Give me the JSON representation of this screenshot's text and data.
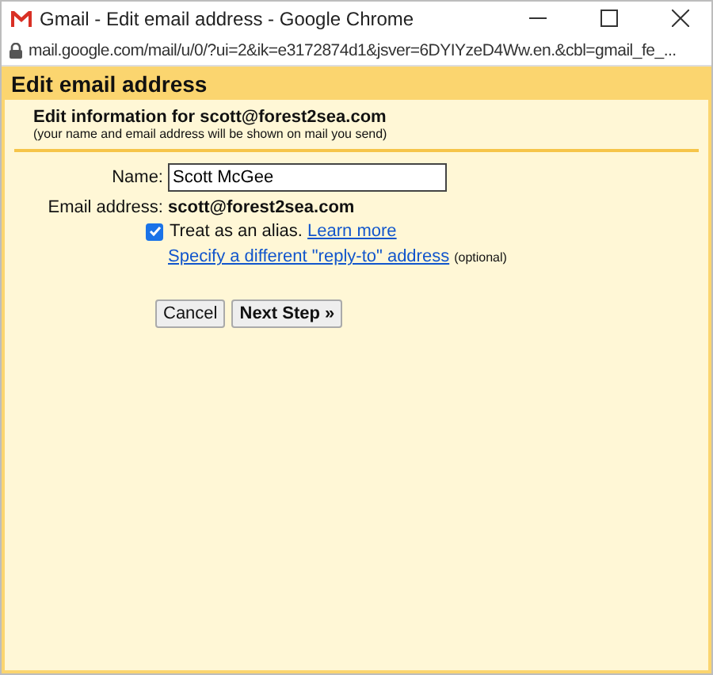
{
  "window": {
    "title": "Gmail - Edit email address - Google Chrome",
    "url": "mail.google.com/mail/u/0/?ui=2&ik=e3172874d1&jsver=6DYIYzeD4Ww.en.&cbl=gmail_fe_..."
  },
  "dialog": {
    "title": "Edit email address",
    "heading": "Edit information for scott@forest2sea.com",
    "subheading": "(your name and email address will be shown on mail you send)",
    "fields": [
      {
        "label": "Name:",
        "kind": "input",
        "value": "Scott McGee"
      },
      {
        "label": "Email address:",
        "kind": "static",
        "value": "scott@forest2sea.com"
      }
    ],
    "alias": {
      "checked": true,
      "label": "Treat as an alias.",
      "link": "Learn more"
    },
    "reply_to": {
      "link": "Specify a different \"reply-to\" address",
      "note": "(optional)"
    },
    "buttons": [
      {
        "label": "Cancel",
        "kind": "secondary"
      },
      {
        "label": "Next Step »",
        "kind": "primary"
      }
    ]
  }
}
